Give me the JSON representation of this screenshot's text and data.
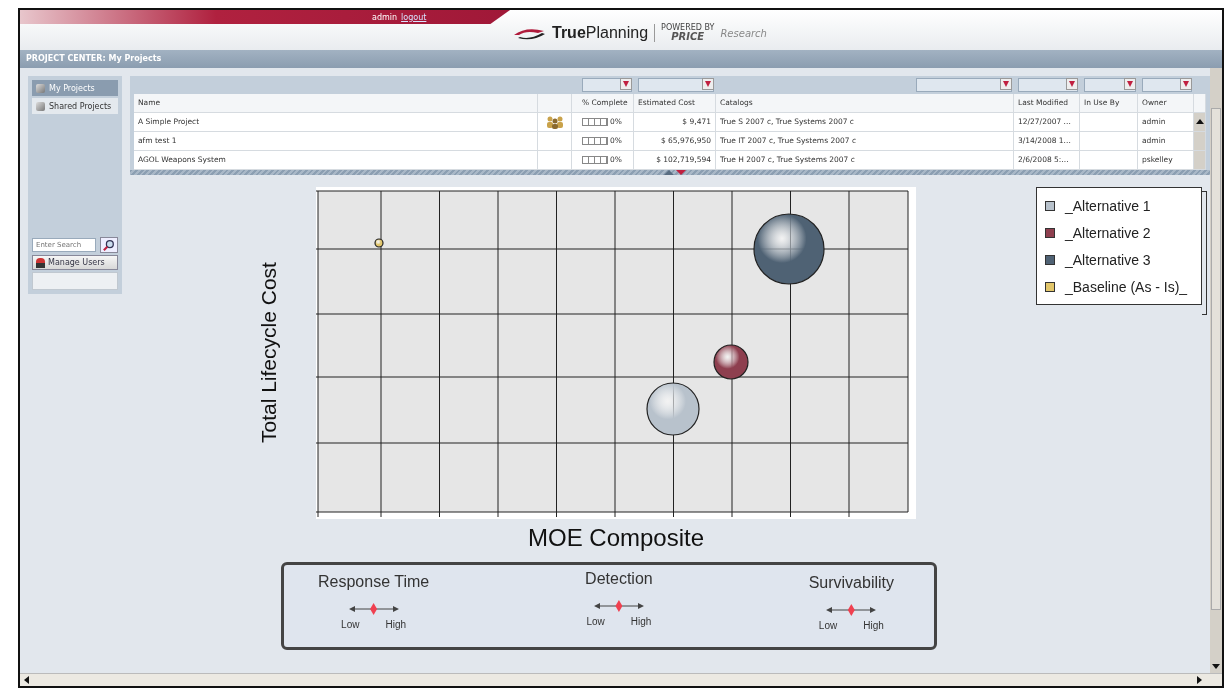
{
  "header": {
    "user": "admin",
    "logout": "logout",
    "brand": {
      "name": "**True**Planning",
      "powered_by": "POWERED BY",
      "partner": "PRICE",
      "partner_suffix": "Research"
    }
  },
  "title_bar": "PROJECT CENTER: My Projects",
  "sidebar": {
    "items": [
      {
        "label": "My Projects",
        "selected": true
      },
      {
        "label": "Shared Projects",
        "selected": false
      }
    ],
    "search": {
      "placeholder": "Enter Search"
    },
    "manage_users": "Manage Users"
  },
  "table": {
    "columns": [
      "Name",
      "% Complete",
      "Estimated Cost",
      "Catalogs",
      "Last Modified",
      "In Use By",
      "Owner"
    ],
    "rows": [
      {
        "name": "A Simple Project",
        "shared": true,
        "level": 0,
        "complete": "0%",
        "cost": "$ 9,471",
        "catalogs": "True S 2007 c, True Systems 2007 c",
        "modified": "12/27/2007 ...",
        "in_use_by": "",
        "owner": "admin"
      },
      {
        "name": "afm test 1",
        "shared": false,
        "level": 0,
        "complete": "0%",
        "cost": "$ 65,976,950",
        "catalogs": "True IT 2007 c, True Systems 2007 c",
        "modified": "3/14/2008 1...",
        "in_use_by": "",
        "owner": "admin"
      },
      {
        "name": "AGOL Weapons System",
        "shared": false,
        "level": 0,
        "complete": "0%",
        "cost": "$ 102,719,594",
        "catalogs": "True H 2007 c, True Systems 2007 c",
        "modified": "2/6/2008 5:...",
        "in_use_by": "",
        "owner": "pskelley"
      }
    ]
  },
  "chart": {
    "xlabel": "MOE Composite",
    "ylabel": "Total Lifecycle Cost",
    "legend": [
      {
        "label": "_Alternative 1",
        "color": "#b8c2cc"
      },
      {
        "label": "_Alternative 2",
        "color": "#8e3f4f"
      },
      {
        "label": "_Alternative 3",
        "color": "#4f6274"
      },
      {
        "label": "_Baseline (As - Is)_",
        "color": "#e2c66a"
      }
    ]
  },
  "sliders": [
    {
      "title": "Response Time",
      "level": 0.5,
      "low": "Low",
      "high": "High"
    },
    {
      "title": "Detection",
      "level": 0.5,
      "low": "Low",
      "high": "High"
    },
    {
      "title": "Survivability",
      "level": 0.5,
      "low": "Low",
      "high": "High"
    }
  ]
}
